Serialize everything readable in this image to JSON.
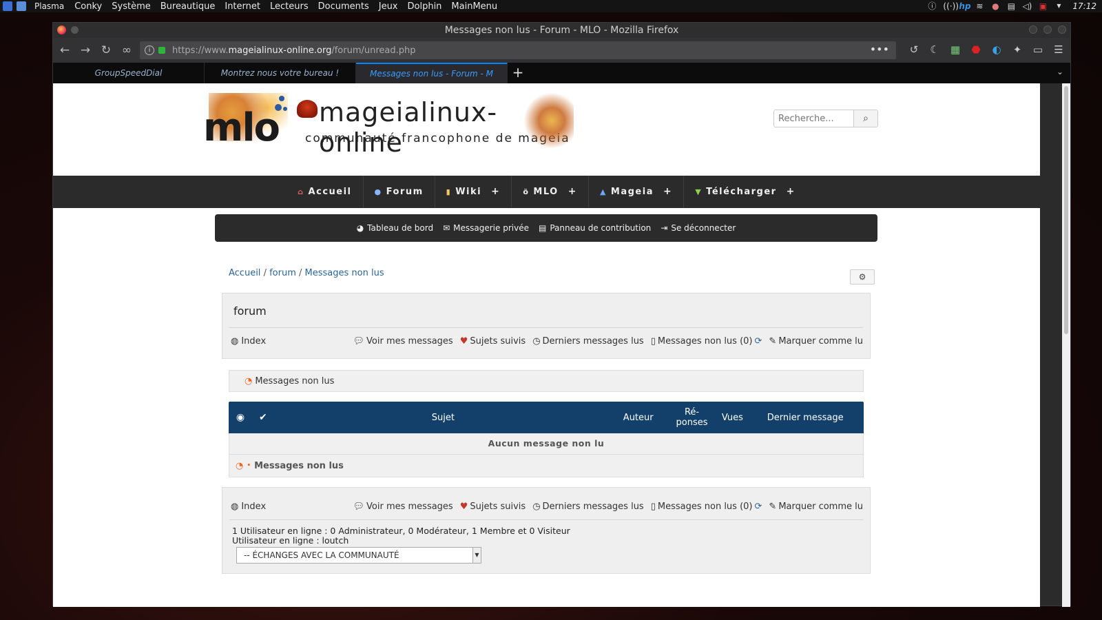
{
  "kde": {
    "plasma_label": "Plasma",
    "menu": [
      "Conky",
      "Système",
      "Bureautique",
      "Internet",
      "Lecteurs",
      "Documents",
      "Jeux",
      "Dolphin",
      "MainMenu"
    ],
    "clock": "17:12"
  },
  "firefox": {
    "window_title": "Messages non lus - Forum - MLO - Mozilla Firefox",
    "url_prefix": "https://www.",
    "url_host": "mageialinux-online.org",
    "url_path": "/forum/unread.php",
    "url_menu": "•••",
    "tabs": [
      {
        "label": "GroupSpeedDial",
        "active": false
      },
      {
        "label": "Montrez nous votre bureau !",
        "active": false
      },
      {
        "label": "Messages non lus - Forum - M",
        "active": true
      }
    ],
    "new_tab": "+"
  },
  "site": {
    "logo_mlo": "mlo",
    "logo_name": "mageialinux-online",
    "logo_tagline": "communauté francophone de mageia",
    "search_placeholder": "Recherche...",
    "nav": [
      {
        "label": "Accueil",
        "icon": "home-icon",
        "plus": false
      },
      {
        "label": "Forum",
        "icon": "globe-icon",
        "plus": false
      },
      {
        "label": "Wiki",
        "icon": "book-icon",
        "plus": true
      },
      {
        "label": "MLO",
        "icon": "mlo-icon",
        "plus": true
      },
      {
        "label": "Mageia",
        "icon": "mageia-icon",
        "plus": true
      },
      {
        "label": "Télécharger",
        "icon": "download-icon",
        "plus": true
      }
    ],
    "plus_symbol": "+",
    "user_bar": {
      "dashboard": "Tableau de bord",
      "messaging": "Messagerie privée",
      "contribution": "Panneau de contribution",
      "logout": "Se déconnecter"
    },
    "breadcrumb": {
      "home": "Accueil",
      "forum": "forum",
      "current": "Messages non lus",
      "sep": "/"
    },
    "forum_title": "forum",
    "links": {
      "index": "Index",
      "my_messages": "Voir mes messages",
      "followed": "Sujets suivis",
      "last_read": "Derniers messages lus",
      "unread": "Messages non lus (0)",
      "mark_read": "Marquer comme lu"
    },
    "unread_box_label": "Messages non lus",
    "table": {
      "col_subject": "Sujet",
      "col_author": "Auteur",
      "col_replies_1": "Ré-",
      "col_replies_2": "ponses",
      "col_views": "Vues",
      "col_last": "Dernier message",
      "empty": "Aucun message non lu",
      "footer_sep": "•",
      "footer": "Messages non lus"
    },
    "online_line1": "1 Utilisateur en ligne : 0 Administrateur, 0 Modérateur, 1 Membre et 0 Visiteur",
    "online_line2": "Utilisateur en ligne : loutch",
    "jump_select": "-- ÉCHANGES AVEC LA COMMUNAUTÉ"
  }
}
